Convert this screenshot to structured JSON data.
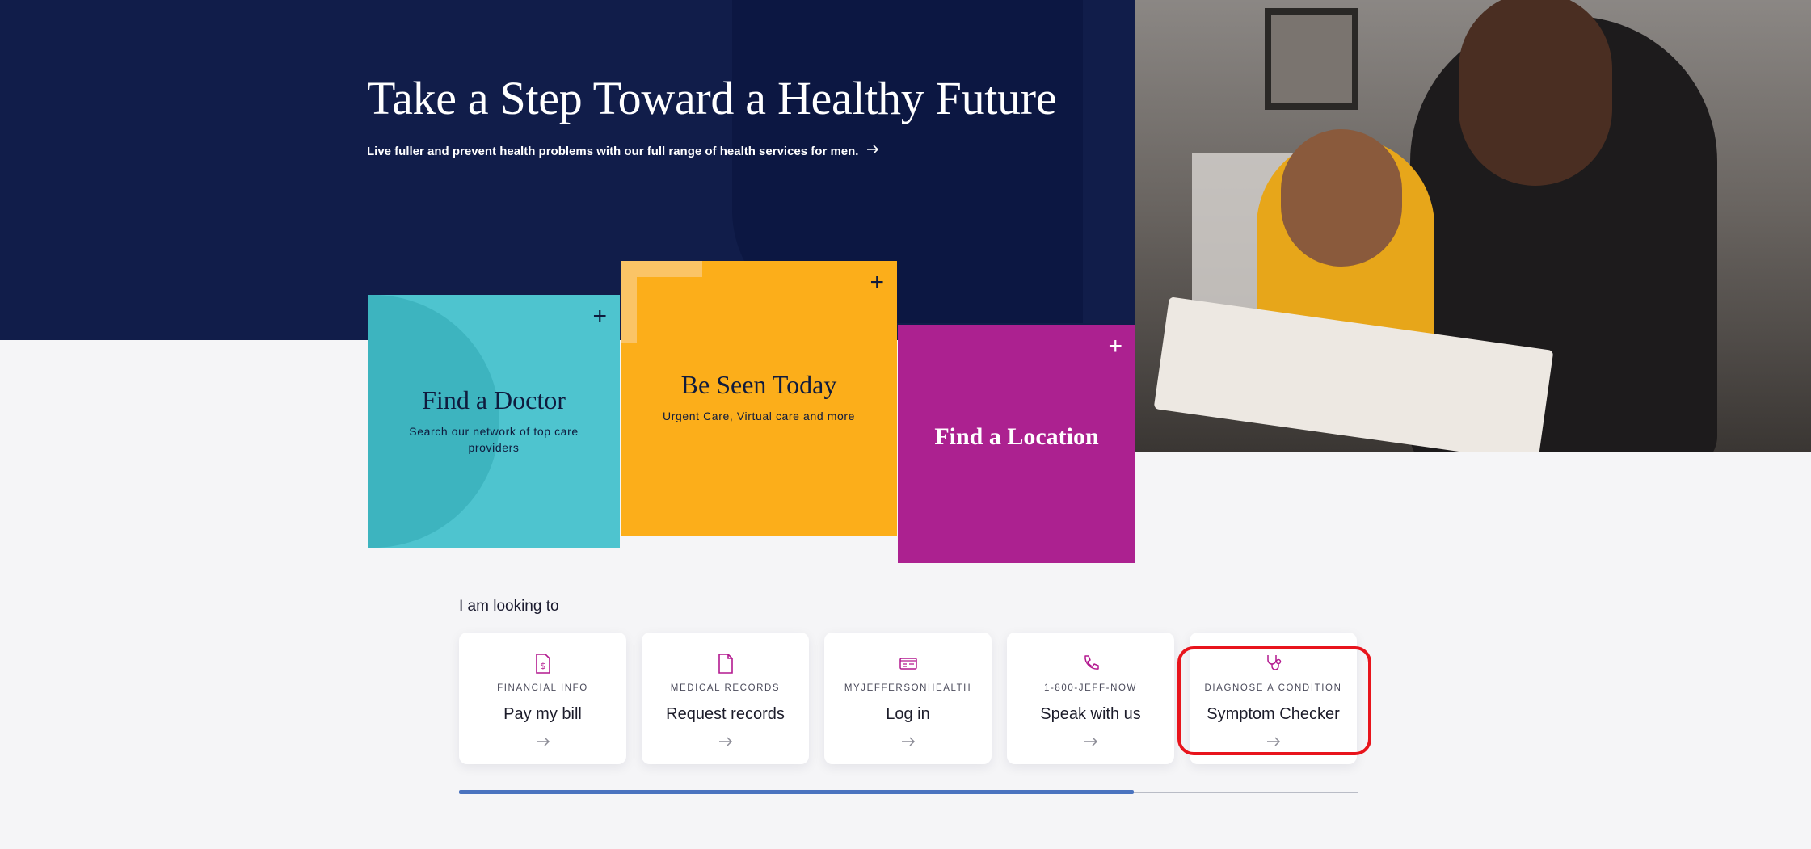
{
  "hero": {
    "title": "Take a Step Toward a Healthy Future",
    "subtitle": "Live fuller and prevent health problems with our full range of health services for men.",
    "subtitle_icon": "arrow-right-icon",
    "background_color": "#111d4a",
    "photo_alt": "father-reading-book-with-daughter-photo"
  },
  "cards": {
    "doctor": {
      "title": "Find a Doctor",
      "description": "Search our network of top care providers",
      "color": "#4ec4cf",
      "icon": "plus-icon"
    },
    "seen": {
      "title": "Be Seen Today",
      "description": "Urgent Care, Virtual care and more",
      "color": "#fcae1a",
      "icon": "plus-icon"
    },
    "location": {
      "title": "Find a Location",
      "color": "#ac2190",
      "icon": "plus-icon"
    }
  },
  "looking": {
    "label": "I am looking to",
    "tiles": [
      {
        "eyebrow": "FINANCIAL INFO",
        "label": "Pay my bill",
        "icon": "bill-document-icon"
      },
      {
        "eyebrow": "MEDICAL RECORDS",
        "label": "Request records",
        "icon": "document-icon"
      },
      {
        "eyebrow": "MYJEFFERSONHEALTH",
        "label": "Log in",
        "icon": "id-card-icon"
      },
      {
        "eyebrow": "1-800-JEFF-NOW",
        "label": "Speak with us",
        "icon": "phone-icon"
      },
      {
        "eyebrow": "DIAGNOSE A CONDITION",
        "label": "Symptom Checker",
        "icon": "stethoscope-icon"
      }
    ]
  },
  "accent_color": "#b3198f",
  "highlight_color": "#e8141c",
  "carousel_progress": 0.75
}
